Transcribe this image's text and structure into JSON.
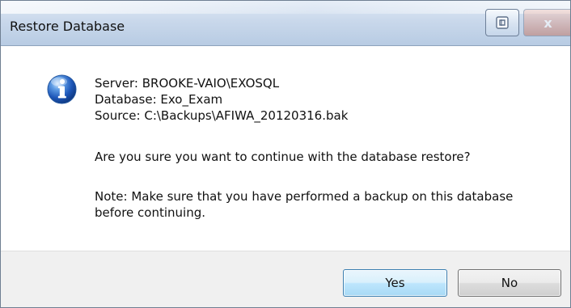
{
  "window": {
    "title": "Restore Database",
    "help_icon": "help-icon",
    "close_label": "x"
  },
  "message": {
    "icon": "information-icon",
    "server": "Server: BROOKE-VAIO\\EXOSQL",
    "database": "Database: Exo_Exam",
    "source": "Source: C:\\Backups\\AFIWA_20120316.bak",
    "question": "Are you sure you want to continue with the database restore?",
    "note_line1": "Note: Make sure that you have performed a backup on this database",
    "note_line2": "before continuing."
  },
  "buttons": {
    "yes_label": "Yes",
    "no_label": "No"
  },
  "colors": {
    "titlebar": "#c9d8eb",
    "footer": "#f0f0f0",
    "default_button_border": "#3c7fb1"
  }
}
